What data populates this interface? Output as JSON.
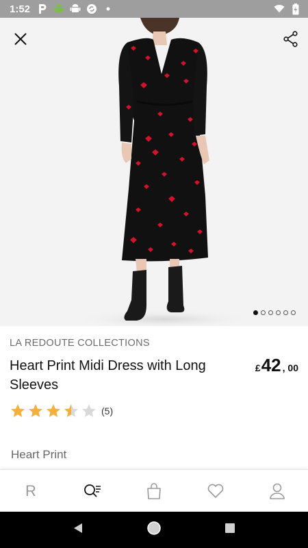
{
  "status_bar": {
    "time": "1:52",
    "left_icons": [
      "parking-icon",
      "android-icon",
      "android-debug-icon",
      "sync-icon",
      "dot-icon"
    ],
    "right_icons": [
      "wifi-icon",
      "battery-icon"
    ]
  },
  "hero": {
    "image_count": 6,
    "active_index": 0
  },
  "product": {
    "brand": "LA REDOUTE COLLECTIONS",
    "title": "Heart Print Midi Dress with Long Sleeves",
    "price": {
      "currency": "£",
      "whole": "42",
      "decimal": ", 00"
    },
    "rating": {
      "value": 3.5,
      "max": 5,
      "count_text": "(5)"
    },
    "colour": "Heart Print"
  },
  "bottom_nav": {
    "items": [
      {
        "name": "home",
        "label": "R"
      },
      {
        "name": "search",
        "label": ""
      },
      {
        "name": "basket",
        "label": ""
      },
      {
        "name": "wishlist",
        "label": ""
      },
      {
        "name": "account",
        "label": ""
      }
    ]
  },
  "colors": {
    "star": "#f4b03e",
    "star_empty": "#d9d9d9",
    "status_bar": "#9e9e9e",
    "text": "#111111",
    "muted": "#6b6b6b"
  }
}
